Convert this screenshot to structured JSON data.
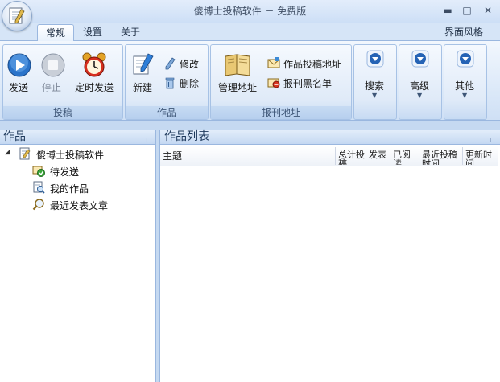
{
  "window": {
    "title": "傻博士投稿软件 － 免费版",
    "minimize_glyph": "▬",
    "maximize_glyph": "□",
    "close_glyph": "✕"
  },
  "menu": {
    "tabs": [
      "常规",
      "设置",
      "关于"
    ],
    "active_tab": "常规",
    "skin_label": "界面风格",
    "skin_dropdown_glyph": "▾"
  },
  "ribbon": {
    "groups": {
      "submit": {
        "label": "投稿",
        "buttons": {
          "send": "发送",
          "stop": "停止",
          "scheduled_send": "定时发送"
        }
      },
      "works": {
        "label": "作品",
        "buttons": {
          "new": "新建",
          "edit": "修改",
          "delete": "删除"
        }
      },
      "journal_address": {
        "label": "报刊地址",
        "buttons": {
          "manage": "管理地址",
          "submission_address": "作品投稿地址",
          "blacklist": "报刊黑名单"
        }
      },
      "search": {
        "label": "搜索"
      },
      "advanced": {
        "label": "高级"
      },
      "other": {
        "label": "其他"
      }
    }
  },
  "left_panel": {
    "title": "作品",
    "tree": {
      "root": "傻博士投稿软件",
      "children": [
        "待发送",
        "我的作品",
        "最近发表文章"
      ]
    }
  },
  "right_panel": {
    "title": "作品列表",
    "columns": [
      "主题",
      "总计投稿",
      "发表",
      "已阅读",
      "最近投稿时间",
      "更新时间"
    ]
  },
  "colors": {
    "accent": "#1e395b",
    "ribbon_border": "#9ab7df",
    "background": "#c5d9f1"
  },
  "icons": {
    "app": "notepad-pencil-icon",
    "send": "play-icon",
    "stop": "stop-icon",
    "scheduled": "alarm-clock-icon",
    "new": "notepad-new-icon",
    "edit": "pencil-icon",
    "delete": "trash-icon",
    "manage": "book-icon",
    "submission_address": "envelope-icon",
    "blacklist": "blacklist-icon",
    "dropdown": "circle-down-arrow-icon"
  }
}
